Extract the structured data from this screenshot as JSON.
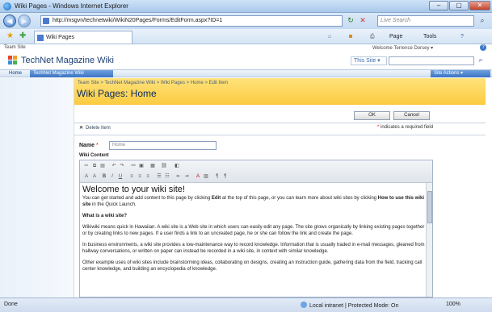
{
  "window": {
    "title": "Wiki Pages - Windows Internet Explorer",
    "min": "–",
    "max": "▢",
    "close": "✕"
  },
  "address": {
    "url": "http://msgvn/technetwiki/WikiN20Pages/Forms/EditForm.aspx?ID=1",
    "search_placeholder": "Live Search"
  },
  "tab": {
    "label": "Wiki Pages"
  },
  "toolbar": {
    "page": "Page",
    "tools": "Tools"
  },
  "sharepoint": {
    "top_left": "Team Site",
    "welcome": "Welcome Terrence Dorsey ▾",
    "site_title": "TechNet Magazine Wiki",
    "scope": "This Site  ▾",
    "nav_home": "Home",
    "nav_current": "TechNet Magazine Wiki",
    "site_actions": "Site Actions ▾"
  },
  "page": {
    "breadcrumb": "Team Site > TechNet Magazine Wiki > Wiki Pages > Home > Edit Item",
    "title": "Wiki Pages: Home"
  },
  "form": {
    "ok": "OK",
    "cancel": "Cancel",
    "delete_item": "Delete Item",
    "required_note": "indicates a required field",
    "name_label": "Name",
    "name_value": "Home",
    "wiki_content_label": "Wiki Content"
  },
  "content": {
    "heading": "Welcome to your wiki site!",
    "p1_a": "You can get started and add content to this page by clicking ",
    "p1_edit": "Edit",
    "p1_b": " at the top of this page, or you can learn more about wiki sites by clicking ",
    "p1_link": "How to use this wiki site",
    "p1_c": " in the Quick Launch.",
    "what_is": "What is a wiki site?",
    "p2": "Wikiwiki means quick in Hawaiian. A wiki site is a Web site in which users can easily edit any page. The site grows organically by linking existing pages together or by creating links to new pages. If a user finds a link to an uncreated page, he or she can follow the link and create the page.",
    "p3": "In business environments, a wiki site provides a low-maintenance way to record knowledge. Information that is usually traded in e-mail messages, gleaned from hallway conversations, or written on paper can instead be recorded in a wiki site, in context with similar knowledge.",
    "p4": "Other example uses of wiki sites include brainstorming ideas, collaborating on designs, creating an instruction guide, gathering data from the field, tracking call center knowledge, and building an encyclopedia of knowledge."
  },
  "status": {
    "left": "Done",
    "zone": "Local intranet | Protected Mode: On",
    "zoom": "100%"
  },
  "colors": {
    "accent": "#3c74c2",
    "header_yellow": "#fbcb41",
    "required": "#dd0000"
  }
}
